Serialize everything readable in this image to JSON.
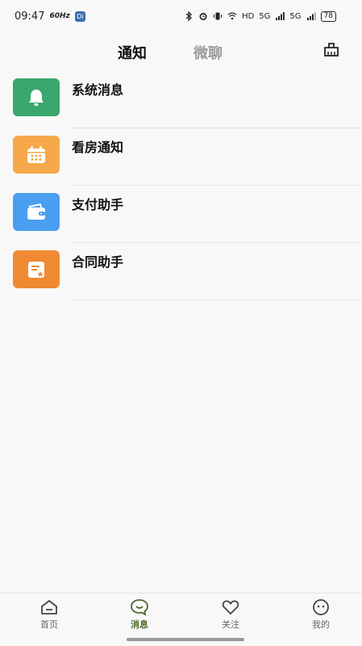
{
  "status_bar": {
    "time": "09:47",
    "refresh": "60Hz",
    "app_badge": "Di",
    "hd1": "HD",
    "hd2": "HD",
    "net1": "5G",
    "net2": "5G",
    "battery": "78"
  },
  "top_nav": {
    "tabs": [
      {
        "label": "通知",
        "active": true
      },
      {
        "label": "微聊",
        "active": false
      }
    ],
    "right_icon": "clean-broom-icon"
  },
  "messages": [
    {
      "label": "系统消息",
      "icon": "bell-icon",
      "color": "#3aa76d"
    },
    {
      "label": "看房通知",
      "icon": "calendar-icon",
      "color": "#f5a94a"
    },
    {
      "label": "支付助手",
      "icon": "wallet-icon",
      "color": "#4a9ff0"
    },
    {
      "label": "合同助手",
      "icon": "contract-icon",
      "color": "#f08a32"
    }
  ],
  "bottom_nav": [
    {
      "label": "首页",
      "icon": "home-icon",
      "active": false
    },
    {
      "label": "消息",
      "icon": "message-icon",
      "active": true
    },
    {
      "label": "关注",
      "icon": "heart-icon",
      "active": false
    },
    {
      "label": "我的",
      "icon": "profile-face-icon",
      "active": false
    }
  ],
  "colors": {
    "accent": "#4b6b2a",
    "inactive_tab": "#9a9a9a",
    "background": "#f8f8f8"
  }
}
